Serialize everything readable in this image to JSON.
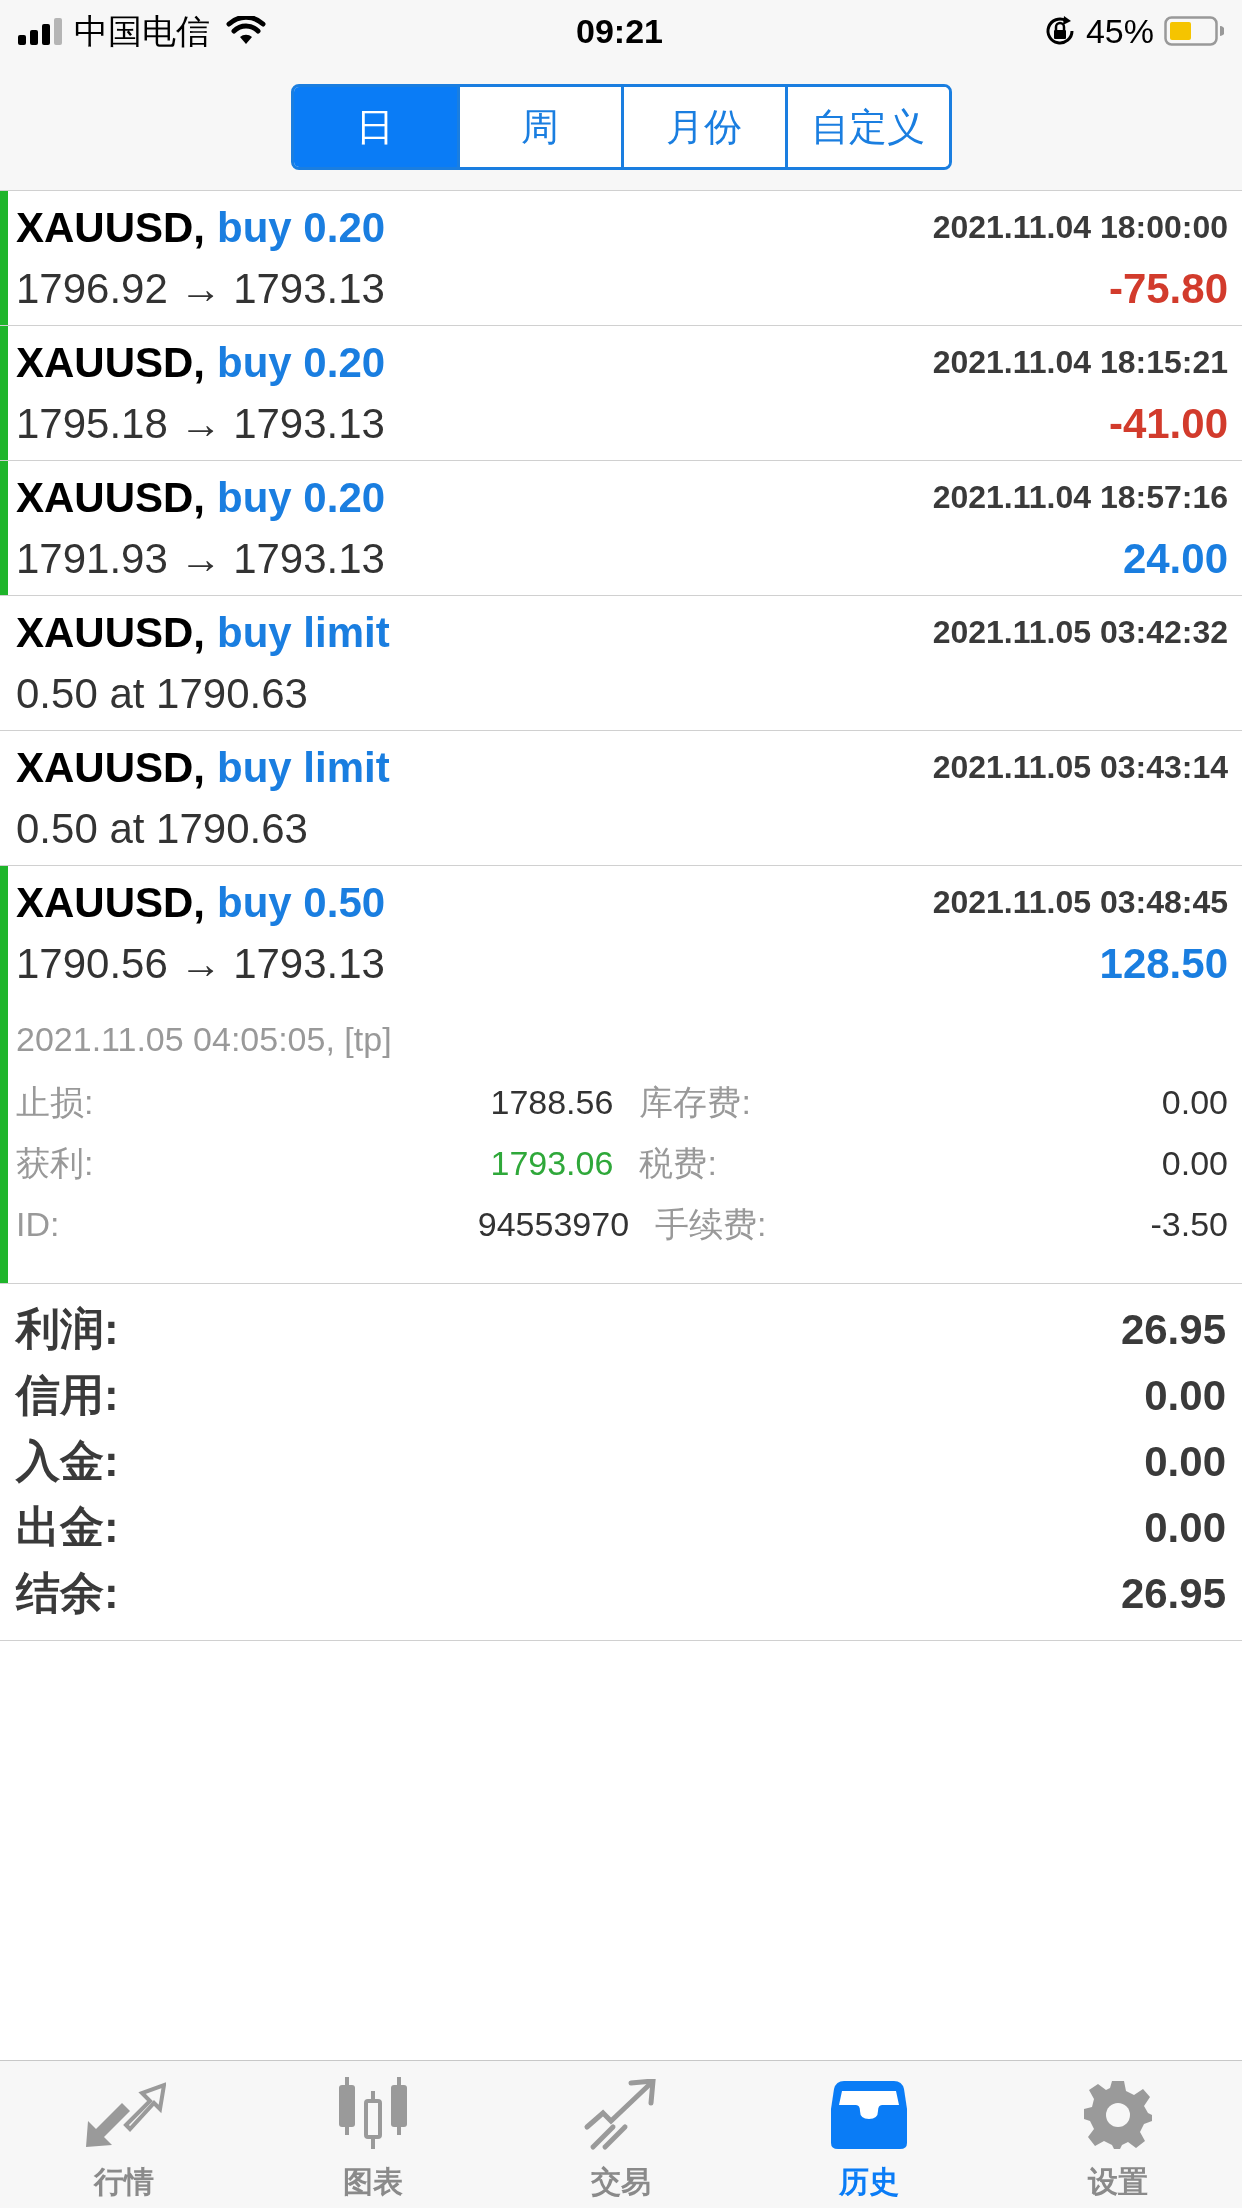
{
  "status_bar": {
    "carrier": "中国电信",
    "time": "09:21",
    "battery": "45%"
  },
  "period_tabs": [
    {
      "label": "日",
      "selected": true
    },
    {
      "label": "周",
      "selected": false
    },
    {
      "label": "月份",
      "selected": false
    },
    {
      "label": "自定义",
      "selected": false
    }
  ],
  "history": [
    {
      "kind": "deal",
      "symbol": "XAUUSD,",
      "type": "buy 0.20",
      "time": "2021.11.04 18:00:00",
      "prices": "1796.92 → 1793.13",
      "profit": "-75.80",
      "color": "#d23b2c"
    },
    {
      "kind": "deal",
      "symbol": "XAUUSD,",
      "type": "buy 0.20",
      "time": "2021.11.04 18:15:21",
      "prices": "1795.18 → 1793.13",
      "profit": "-41.00",
      "color": "#d23b2c"
    },
    {
      "kind": "deal",
      "symbol": "XAUUSD,",
      "type": "buy 0.20",
      "time": "2021.11.04 18:57:16",
      "prices": "1791.93 → 1793.13",
      "profit": "24.00",
      "color": "#1a7ee0"
    },
    {
      "kind": "order",
      "symbol": "XAUUSD,",
      "type": "buy limit",
      "time": "2021.11.05 03:42:32",
      "prices": "0.50 at 1790.63"
    },
    {
      "kind": "order",
      "symbol": "XAUUSD,",
      "type": "buy limit",
      "time": "2021.11.05 03:43:14",
      "prices": "0.50 at 1790.63"
    },
    {
      "kind": "deal",
      "symbol": "XAUUSD,",
      "type": "buy 0.50",
      "time": "2021.11.05 03:48:45",
      "prices": "1790.56 → 1793.13",
      "profit": "128.50",
      "color": "#1a7ee0",
      "details": {
        "close": "2021.11.05 04:05:05, [tp]",
        "fields": [
          {
            "label": "止损:",
            "value": "1788.56",
            "label2": "库存费:",
            "value2": "0.00",
            "color": "#333333"
          },
          {
            "label": "获利:",
            "value": "1793.06",
            "label2": "税费:",
            "value2": "0.00",
            "color": "#2fa83a"
          },
          {
            "label": "ID:",
            "value": "94553970",
            "label2": "手续费:",
            "value2": "-3.50",
            "color": "#333333"
          }
        ]
      }
    }
  ],
  "summary": [
    {
      "label": "利润:",
      "value": "26.95"
    },
    {
      "label": "信用:",
      "value": "0.00"
    },
    {
      "label": "入金:",
      "value": "0.00"
    },
    {
      "label": "出金:",
      "value": "0.00"
    },
    {
      "label": "结余:",
      "value": "26.95"
    }
  ],
  "tab_bar": [
    {
      "kind": "quotes",
      "label": "行情",
      "selected": false
    },
    {
      "kind": "chart",
      "label": "图表",
      "selected": false
    },
    {
      "kind": "trade",
      "label": "交易",
      "selected": false
    },
    {
      "kind": "history",
      "label": "历史",
      "selected": true
    },
    {
      "kind": "settings",
      "label": "设置",
      "selected": false
    }
  ]
}
